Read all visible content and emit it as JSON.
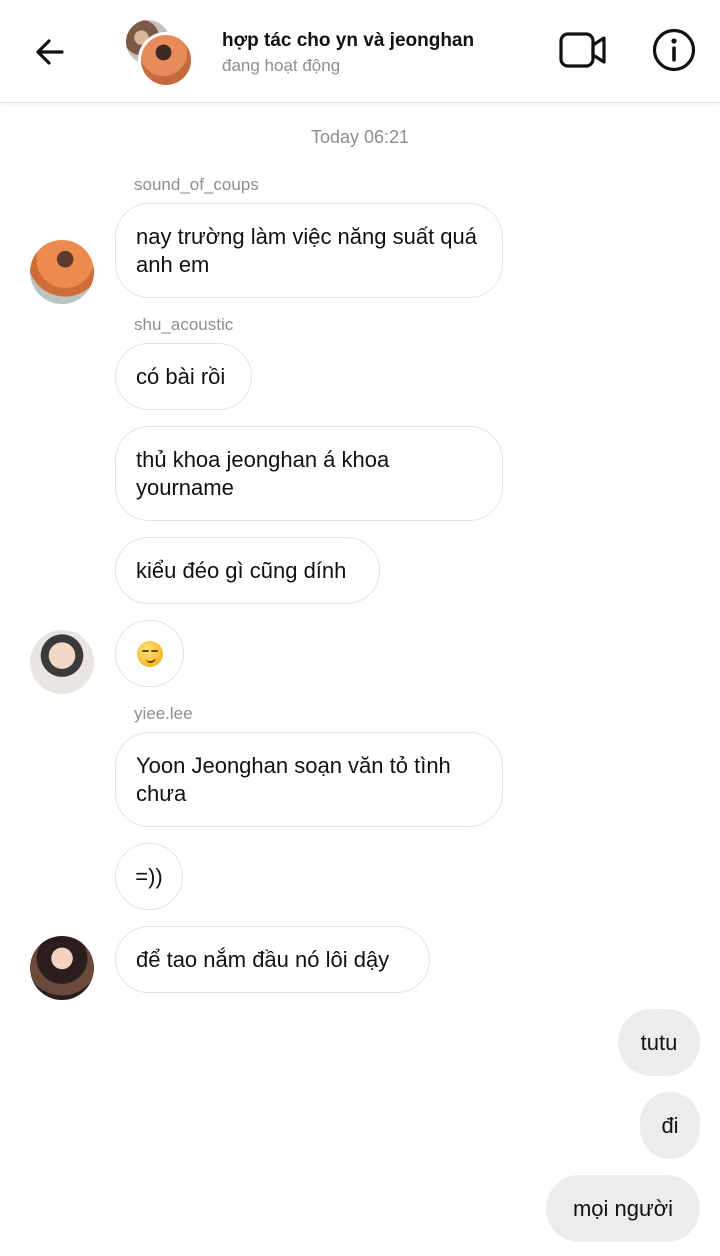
{
  "header": {
    "title": "hợp tác cho yn và jeonghan",
    "status": "đang hoạt động",
    "icons": {
      "back": "back-arrow-icon",
      "video": "video-call-icon",
      "info": "info-icon"
    }
  },
  "chat": {
    "timestamp": "Today 06:21",
    "groups": [
      {
        "sender": "sound_of_coups",
        "messages": [
          "nay trường làm việc năng suất quá anh em"
        ]
      },
      {
        "sender": "shu_acoustic",
        "messages": [
          "có bài rồi",
          "thủ khoa jeonghan á khoa yourname",
          "kiểu đéo gì cũng dính",
          "😏"
        ]
      },
      {
        "sender": "yiee.lee",
        "messages": [
          "Yoon Jeonghan soạn văn tỏ tình chưa",
          "=))",
          "để tao nắm đầu nó lôi dậy"
        ]
      }
    ],
    "outgoing": [
      "tutu",
      "đi",
      "mọi người"
    ]
  },
  "colors": {
    "background": "#ffffff",
    "incoming_border": "#e4e4e4",
    "outgoing_bubble": "#ececec",
    "muted_text": "#8e8e8e"
  }
}
